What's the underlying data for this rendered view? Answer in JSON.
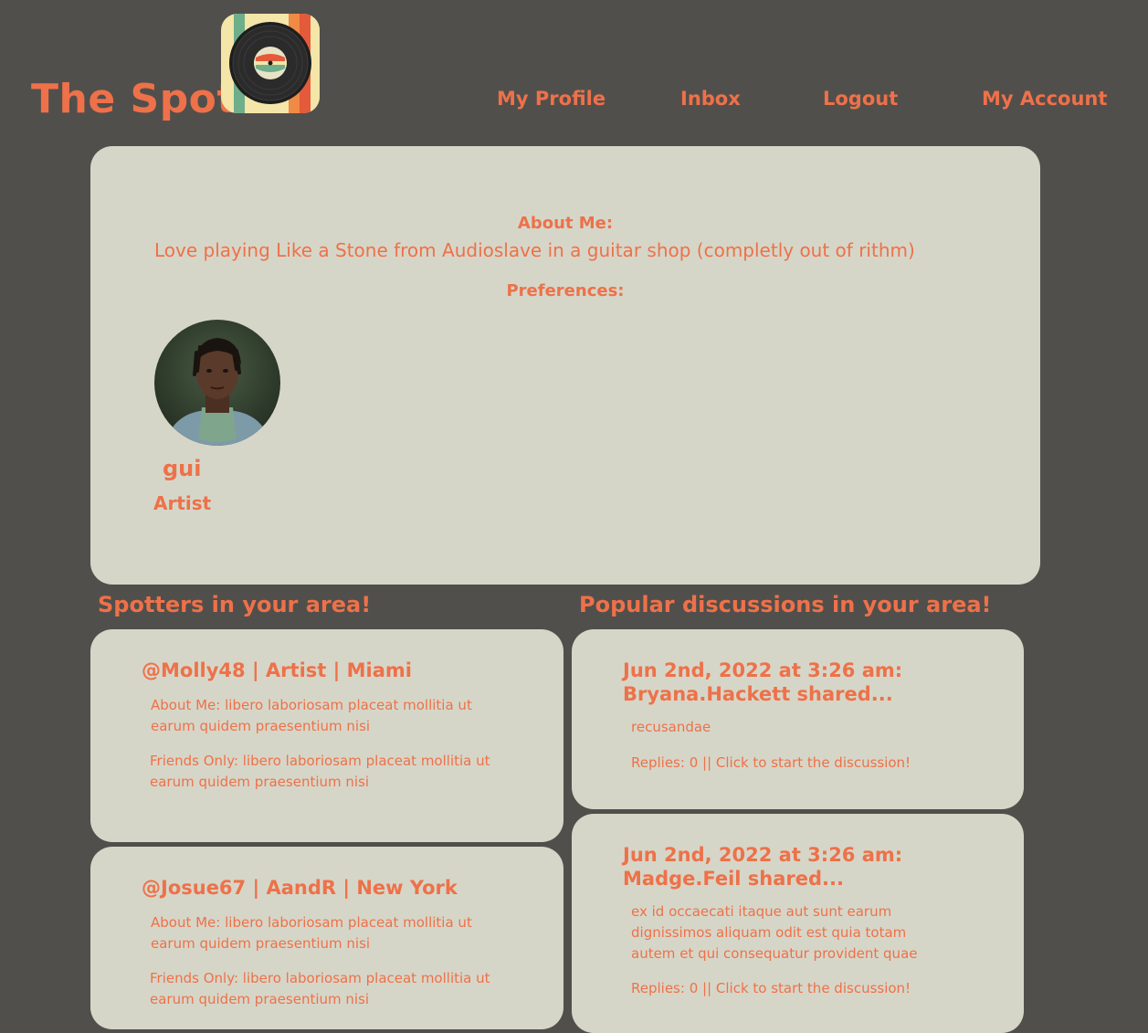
{
  "header": {
    "title": "The Spot",
    "logo_icon": "vinyl-record-icon",
    "nav": {
      "my_profile": "My Profile",
      "inbox": "Inbox",
      "logout": "Logout",
      "my_account": "My Account"
    }
  },
  "profile": {
    "about_heading": "About Me:",
    "about_text": "Love playing Like a Stone from Audioslave in a guitar shop (completly out of rithm)",
    "preferences_heading": "Preferences:",
    "username": "gui",
    "role": "Artist"
  },
  "spotters": {
    "heading": "Spotters in your area!",
    "items": [
      {
        "title": "@Molly48 | Artist | Miami",
        "about": "About Me: libero laboriosam placeat mollitia ut earum quidem praesentium nisi",
        "friends": "Friends Only: libero laboriosam placeat mollitia ut earum quidem praesentium nisi"
      },
      {
        "title": "@Josue67 | AandR | New York",
        "about": "About Me: libero laboriosam placeat mollitia ut earum quidem praesentium nisi",
        "friends": "Friends Only: libero laboriosam placeat mollitia ut earum quidem praesentium nisi"
      }
    ]
  },
  "discussions": {
    "heading": "Popular discussions in your area!",
    "items": [
      {
        "title": "Jun 2nd, 2022 at 3:26 am: Bryana.Hackett shared...",
        "body": "recusandae",
        "replies": "Replies: 0 || Click to start the discussion!"
      },
      {
        "title": "Jun 2nd, 2022 at 3:26 am: Madge.Feil shared...",
        "body": "ex id occaecati itaque aut sunt earum dignissimos aliquam odit est quia totam autem et qui consequatur provident quae",
        "replies": "Replies: 0 || Click to start the discussion!"
      }
    ]
  },
  "colors": {
    "background": "#514f4c",
    "card": "#d6d6c8",
    "accent": "#ee7149"
  }
}
